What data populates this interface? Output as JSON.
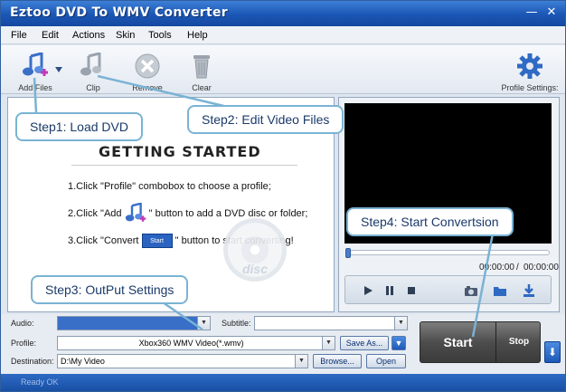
{
  "window": {
    "title": "Eztoo DVD To WMV Converter",
    "minimize": "—",
    "close": "✕"
  },
  "menu": [
    "File",
    "Edit",
    "Actions",
    "Skin",
    "Tools",
    "Help"
  ],
  "toolbar": {
    "add_files": "Add Files",
    "clip": "Clip",
    "remove": "Remove",
    "clear": "Clear",
    "profile_settings": "Profile Settings:"
  },
  "getting_started": {
    "title": "GETTING STARTED",
    "step1": "1.Click \"Profile\" combobox to choose a profile;",
    "step2_pre": "2.Click \"Add",
    "step2_post": "\" button to add a DVD disc or folder;",
    "step3_pre": "3.Click \"Convert",
    "step3_btn": "Start",
    "step3_post": "\" button to start converting!",
    "disc_text": "disc"
  },
  "player": {
    "current_time": "00:00:00",
    "separator": "/",
    "total_time": "00:00:00",
    "seek_fraction": 0
  },
  "settings": {
    "audio_label": "Audio:",
    "audio_value": "",
    "subtitle_label": "Subtitle:",
    "subtitle_value": "",
    "profile_label": "Profile:",
    "profile_value": "Xbox360 WMV Video(*.wmv)",
    "save_as": "Save As...",
    "destination_label": "Destination:",
    "destination_value": "D:\\My Video",
    "browse": "Browse...",
    "open": "Open"
  },
  "actions": {
    "start": "Start",
    "stop": "Stop",
    "down_arrow": "⬇"
  },
  "status": {
    "text": "Ready OK"
  },
  "callouts": {
    "step1": "Step1: Load DVD",
    "step2": "Step2: Edit Video Files",
    "step3": "Step3: OutPut Settings",
    "step4": "Step4: Start Convertsion"
  },
  "colors": {
    "title_bar": "#1a56b5",
    "accent": "#2a63c0",
    "video_bg": "#000000",
    "callout_border": "#7ab3d4"
  }
}
